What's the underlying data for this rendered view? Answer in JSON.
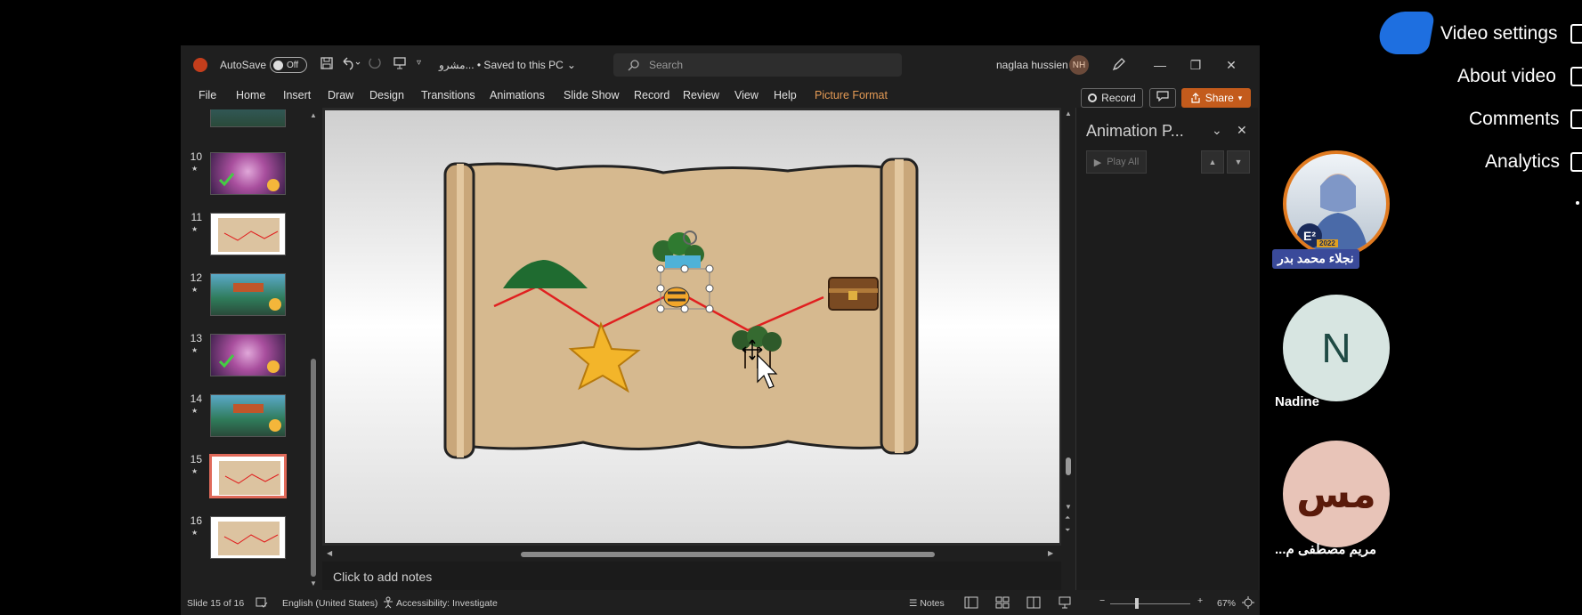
{
  "titlebar": {
    "autosave_label": "AutoSave",
    "toggle_state": "Off",
    "doc_title": "مشرو... • Saved to this PC",
    "chevron": "⌄",
    "search_placeholder": "Search",
    "user_name": "naglaa hussien",
    "user_initials": "NH"
  },
  "menu": {
    "items": [
      "File",
      "Home",
      "Insert",
      "Draw",
      "Design",
      "Transitions",
      "Animations",
      "Slide Show",
      "Record",
      "Review",
      "View",
      "Help",
      "Picture Format"
    ],
    "record_label": "Record",
    "share_label": "Share"
  },
  "thumbnails": [
    {
      "num": "10"
    },
    {
      "num": "11"
    },
    {
      "num": "12"
    },
    {
      "num": "13"
    },
    {
      "num": "14"
    },
    {
      "num": "15"
    },
    {
      "num": "16"
    }
  ],
  "notes": {
    "placeholder": "Click to add notes"
  },
  "animation_pane": {
    "title": "Animation P...",
    "play_all": "Play All"
  },
  "status": {
    "slide_count": "Slide 15 of 16",
    "language": "English (United States)",
    "accessibility": "Accessibility: Investigate",
    "notes_label": "Notes",
    "zoom": "67%"
  },
  "right_menu": {
    "items": [
      "Video settings",
      "About video",
      "Comments",
      "Analytics"
    ]
  },
  "participants": [
    {
      "name": "نجلاء محمد بدر",
      "badge": "E²",
      "badge_year": "2022"
    },
    {
      "initial": "N",
      "name": "Nadine"
    },
    {
      "initial": "مس",
      "name": "...مريم مصطفى م"
    }
  ],
  "colors": {
    "accent_orange": "#c35b1c",
    "picture_format": "#e59b55",
    "selected_thumb": "#e06a5a",
    "video_blob": "#1e6fe0",
    "path_line": "#e02020"
  }
}
